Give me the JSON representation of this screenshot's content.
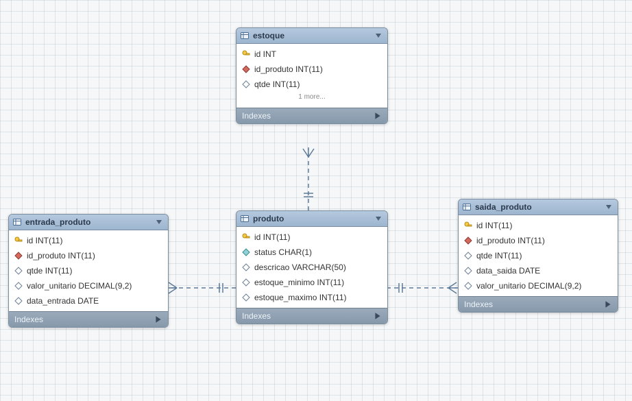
{
  "diagram": {
    "entities": {
      "estoque": {
        "name": "estoque",
        "columns": [
          {
            "icon": "pk",
            "text": "id INT"
          },
          {
            "icon": "fk",
            "text": "id_produto INT(11)"
          },
          {
            "icon": "field",
            "text": "qtde INT(11)"
          }
        ],
        "more_label": "1 more...",
        "indexes_label": "Indexes"
      },
      "entrada_produto": {
        "name": "entrada_produto",
        "columns": [
          {
            "icon": "pk",
            "text": "id INT(11)"
          },
          {
            "icon": "fk",
            "text": "id_produto INT(11)"
          },
          {
            "icon": "field",
            "text": "qtde INT(11)"
          },
          {
            "icon": "field",
            "text": "valor_unitario DECIMAL(9,2)"
          },
          {
            "icon": "field",
            "text": "data_entrada DATE"
          }
        ],
        "indexes_label": "Indexes"
      },
      "produto": {
        "name": "produto",
        "columns": [
          {
            "icon": "pk",
            "text": "id INT(11)"
          },
          {
            "icon": "attr",
            "text": "status CHAR(1)"
          },
          {
            "icon": "field",
            "text": "descricao VARCHAR(50)"
          },
          {
            "icon": "field",
            "text": "estoque_minimo INT(11)"
          },
          {
            "icon": "field",
            "text": "estoque_maximo INT(11)"
          }
        ],
        "indexes_label": "Indexes"
      },
      "saida_produto": {
        "name": "saida_produto",
        "columns": [
          {
            "icon": "pk",
            "text": "id INT(11)"
          },
          {
            "icon": "fk",
            "text": "id_produto INT(11)"
          },
          {
            "icon": "field",
            "text": "qtde INT(11)"
          },
          {
            "icon": "field",
            "text": "data_saida DATE"
          },
          {
            "icon": "field",
            "text": "valor_unitario DECIMAL(9,2)"
          }
        ],
        "indexes_label": "Indexes"
      }
    },
    "relationships": [
      {
        "from": "produto",
        "to": "estoque",
        "type": "one-to-many"
      },
      {
        "from": "produto",
        "to": "entrada_produto",
        "type": "one-to-many"
      },
      {
        "from": "produto",
        "to": "saida_produto",
        "type": "one-to-many"
      }
    ]
  }
}
